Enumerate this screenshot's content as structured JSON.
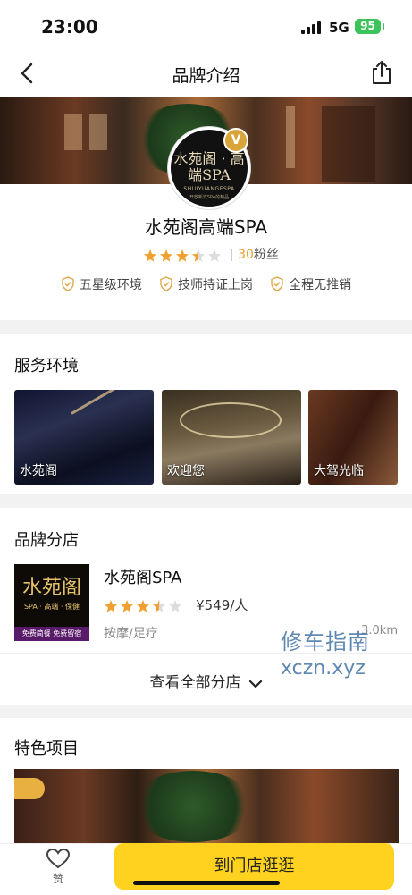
{
  "status_bar": {
    "time": "23:00",
    "network": "5G",
    "battery": "95"
  },
  "nav": {
    "title": "品牌介绍",
    "back_icon": "chevron-left-icon",
    "share_icon": "share-icon"
  },
  "brand": {
    "logo_main": "水苑阁 · 高端SPA",
    "logo_sub": "SHUIYUANGESPA",
    "logo_sub2": "开放新式SPA的精品",
    "badge": "V",
    "name": "水苑阁高端SPA",
    "rating": 3.5,
    "fans_count": "30",
    "fans_label": "粉丝",
    "tags": [
      "五星级环境",
      "技师持证上岗",
      "全程无推销"
    ],
    "accent_color": "#f0a030"
  },
  "environment": {
    "title": "服务环境",
    "images": [
      {
        "caption": "水苑阁"
      },
      {
        "caption": "欢迎您"
      },
      {
        "caption": "大驾光临"
      }
    ]
  },
  "branches": {
    "title": "品牌分店",
    "shop": {
      "image_text": "水苑阁",
      "image_sub": "SPA · 高端 · 保健",
      "image_banner": "免费简餐  免费留宿",
      "name": "水苑阁SPA",
      "rating": 3.5,
      "price": "¥549/人",
      "category": "按摩/足疗",
      "distance": "3.0km"
    },
    "view_all": "查看全部分店"
  },
  "watermark": {
    "line1": "修车指南",
    "line2": "xczn.xyz"
  },
  "featured": {
    "title": "特色项目"
  },
  "bottom": {
    "like_label": "赞",
    "cta": "到门店逛逛"
  }
}
